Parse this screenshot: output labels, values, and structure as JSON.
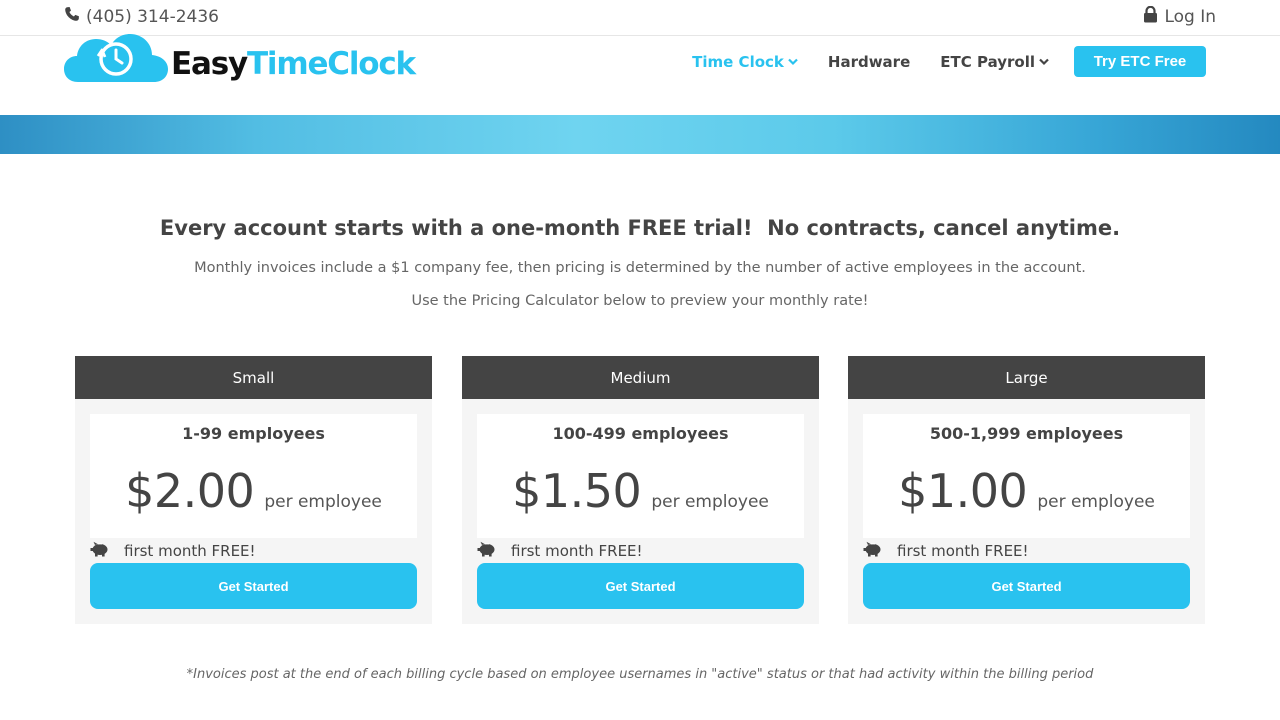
{
  "topbar": {
    "phone": "(405) 314-2436",
    "login": "Log In"
  },
  "logo": {
    "word_easy": "Easy",
    "word_timeclock": "TimeClock"
  },
  "nav": {
    "items": [
      {
        "label": "Time Clock",
        "active": true,
        "dropdown": true
      },
      {
        "label": "Hardware",
        "active": false,
        "dropdown": false
      },
      {
        "label": "ETC Payroll",
        "active": false,
        "dropdown": true
      }
    ],
    "cta": "Try ETC Free"
  },
  "intro": {
    "headline": "Every account starts with a one-month FREE trial!  No contracts, cancel anytime.",
    "line1": "Monthly invoices include a $1 company fee, then pricing is determined by the number of active employees in the account.",
    "line2": "Use the Pricing Calculator below to preview your monthly rate!"
  },
  "plans": [
    {
      "name": "Small",
      "employees": "1-99 employees",
      "price": "$2.00",
      "unit": "per employee",
      "perk": "first month FREE!",
      "button": "Get Started"
    },
    {
      "name": "Medium",
      "employees": "100-499 employees",
      "price": "$1.50",
      "unit": "per employee",
      "perk": "first month FREE!",
      "button": "Get Started"
    },
    {
      "name": "Large",
      "employees": "500-1,999 employees",
      "price": "$1.00",
      "unit": "per employee",
      "perk": "first month FREE!",
      "button": "Get Started"
    }
  ],
  "footnote": "*Invoices post at the end of each billing cycle based on employee usernames in \"active\" status or that had activity within the billing period",
  "colors": {
    "accent": "#29c2ef",
    "dark": "#444444",
    "card_bg": "#f5f5f5"
  },
  "icons": [
    "phone-icon",
    "lock-icon",
    "clock-cloud-logo-icon",
    "chevron-down-icon",
    "piggy-bank-icon"
  ]
}
